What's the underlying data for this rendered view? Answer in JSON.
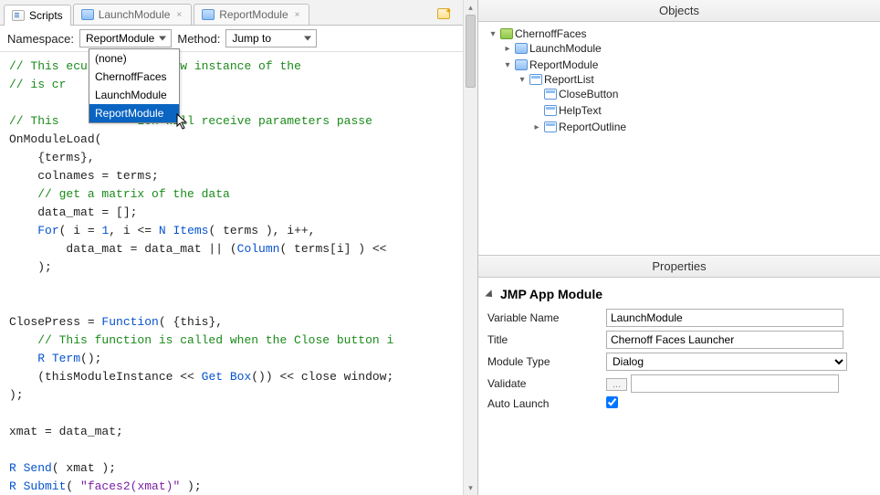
{
  "tabs": [
    {
      "label": "Scripts",
      "icon": "script",
      "closable": false,
      "active": true
    },
    {
      "label": "LaunchModule",
      "icon": "module",
      "closable": true,
      "active": false
    },
    {
      "label": "ReportModule",
      "icon": "module",
      "closable": true,
      "active": false
    }
  ],
  "toolbar": {
    "namespace_label": "Namespace:",
    "namespace_value": "ReportModule",
    "method_label": "Method:",
    "method_value": "Jump to"
  },
  "namespace_options": [
    "(none)",
    "ChernoffFaces",
    "LaunchModule",
    "ReportModule"
  ],
  "namespace_selected_index": 3,
  "code_lines": [
    {
      "t": "// This ",
      "cls": "cm",
      "tail": "ecuted when a new instance of the",
      "tailcls": "cm"
    },
    {
      "t": "// is cr",
      "cls": "cm"
    },
    {
      "t": "",
      "cls": ""
    },
    {
      "t": "// This           ion will receive parameters passe",
      "cls": "cm"
    },
    {
      "t": "OnModuleLoad(",
      "cls": ""
    },
    {
      "t": "    {terms},",
      "cls": ""
    },
    {
      "t": "    colnames = terms;",
      "cls": ""
    },
    {
      "t": "    // get a matrix of the data",
      "cls": "cm"
    },
    {
      "t": "    data_mat = [];",
      "cls": ""
    },
    {
      "raw": "    <span class='kw'>For</span>( i = <span class='num'>1</span>, i &lt;= <span class='kw'>N Items</span>( terms ), i++,"
    },
    {
      "raw": "        data_mat = data_mat || (<span class='kw'>Column</span>( terms[i] ) &lt;&lt;"
    },
    {
      "t": "    );",
      "cls": ""
    },
    {
      "t": "",
      "cls": ""
    },
    {
      "t": "",
      "cls": ""
    },
    {
      "raw": "ClosePress = <span class='kw'>Function</span>( {this},"
    },
    {
      "t": "    // This function is called when the Close button i",
      "cls": "cm"
    },
    {
      "raw": "    <span class='kw'>R Term</span>();"
    },
    {
      "raw": "    (thisModuleInstance &lt;&lt; <span class='kw'>Get Box</span>()) &lt;&lt; close window;"
    },
    {
      "t": ");",
      "cls": ""
    },
    {
      "t": "",
      "cls": ""
    },
    {
      "t": "xmat = data_mat;",
      "cls": ""
    },
    {
      "t": "",
      "cls": ""
    },
    {
      "raw": "<span class='kw'>R Send</span>( xmat );"
    },
    {
      "raw": "<span class='kw'>R Submit</span>( <span class='str'>\"faces2(xmat)\"</span> );"
    }
  ],
  "objects": {
    "title": "Objects",
    "root": "ChernoffFaces",
    "items": [
      {
        "label": "LaunchModule",
        "icon": "module",
        "expandable": true,
        "expanded": false,
        "children": []
      },
      {
        "label": "ReportModule",
        "icon": "module",
        "expandable": true,
        "expanded": true,
        "children": [
          {
            "label": "ReportList",
            "icon": "widget",
            "expandable": true,
            "expanded": true,
            "children": [
              {
                "label": "CloseButton",
                "icon": "widget"
              },
              {
                "label": "HelpText",
                "icon": "widget"
              },
              {
                "label": "ReportOutline",
                "icon": "widget",
                "expandable": true,
                "expanded": false
              }
            ]
          }
        ]
      }
    ]
  },
  "properties": {
    "title": "Properties",
    "section": "JMP App Module",
    "rows": [
      {
        "label": "Variable Name",
        "type": "text",
        "value": "LaunchModule"
      },
      {
        "label": "Title",
        "type": "text",
        "value": "Chernoff Faces Launcher"
      },
      {
        "label": "Module Type",
        "type": "select",
        "value": "Dialog"
      },
      {
        "label": "Validate",
        "type": "button",
        "value": "..."
      },
      {
        "label": "Auto Launch",
        "type": "checkbox",
        "value": true
      }
    ]
  }
}
